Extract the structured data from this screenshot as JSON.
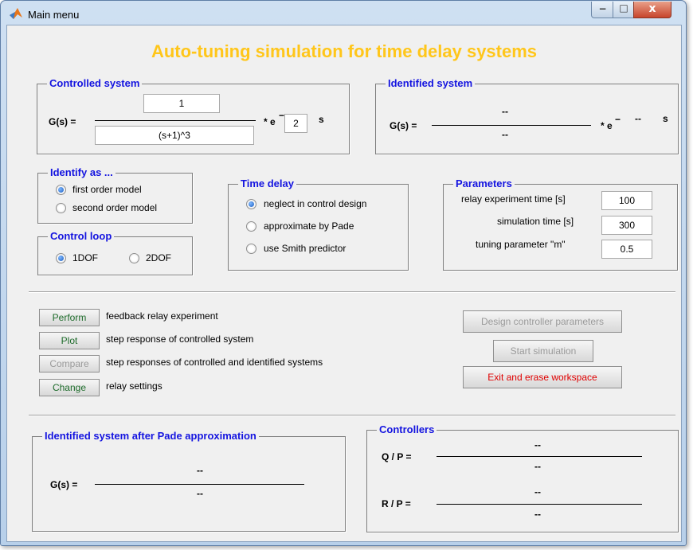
{
  "window": {
    "title": "Main menu",
    "app_icon": "matlab-icon",
    "controls": {
      "minimize": "−",
      "maximize": "□",
      "close": "x"
    }
  },
  "heading": "Auto-tuning simulation for time delay systems",
  "controlled_system": {
    "title": "Controlled system",
    "gs_label": "G(s) =",
    "numerator": "1",
    "denominator": "(s+1)^3",
    "exp_prefix": "* e",
    "exp_sign": "−",
    "delay": "2",
    "unit": "s"
  },
  "identified_system": {
    "title": "Identified system",
    "gs_label": "G(s) =",
    "numerator": "--",
    "denominator": "--",
    "exp_prefix": "* e",
    "exp_sign": "−",
    "delay": "--",
    "unit": "s"
  },
  "identify_as": {
    "title": "Identify as ...",
    "options": [
      "first order model",
      "second order model"
    ],
    "selected": "first order model"
  },
  "control_loop": {
    "title": "Control loop",
    "options": [
      "1DOF",
      "2DOF"
    ],
    "selected": "1DOF"
  },
  "time_delay": {
    "title": "Time delay",
    "options": [
      "neglect in control design",
      "approximate by Pade",
      "use Smith predictor"
    ],
    "selected": "neglect in control design"
  },
  "parameters": {
    "title": "Parameters",
    "fields": [
      {
        "label": "relay experiment time [s]",
        "value": "100"
      },
      {
        "label": "simulation time [s]",
        "value": "300"
      },
      {
        "label": "tuning parameter \"m\"",
        "value": "0.5"
      }
    ]
  },
  "actions": [
    {
      "button": "Perform",
      "description": "feedback relay experiment",
      "enabled": true
    },
    {
      "button": "Plot",
      "description": "step response of controlled system",
      "enabled": true
    },
    {
      "button": "Compare",
      "description": "step responses of controlled and identified systems",
      "enabled": false
    },
    {
      "button": "Change",
      "description": "relay settings",
      "enabled": true
    }
  ],
  "right_buttons": {
    "design": "Design controller parameters",
    "start": "Start simulation",
    "exit": "Exit and erase workspace"
  },
  "pade_system": {
    "title": "Identified system after Pade approximation",
    "gs_label": "G(s) =",
    "numerator": "--",
    "denominator": "--"
  },
  "controllers": {
    "title": "Controllers",
    "qp_label": "Q / P =",
    "qp_numerator": "--",
    "qp_denominator": "--",
    "rp_label": "R / P =",
    "rp_numerator": "--",
    "rp_denominator": "--"
  },
  "colors": {
    "heading": "#ffc61a",
    "frame_title": "#1414e0",
    "active_button_text": "#1d6b2a",
    "exit_text": "#e00000",
    "disabled_text": "#9a9a9a"
  }
}
